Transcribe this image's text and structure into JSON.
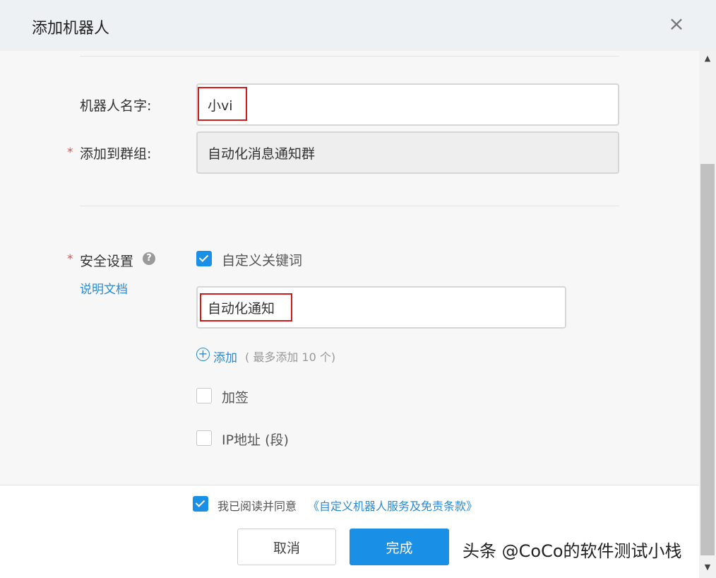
{
  "dialog": {
    "title": "添加机器人",
    "close_icon": "×"
  },
  "form": {
    "robot_name_label": "机器人名字:",
    "robot_name_value": "小vi",
    "group_label": "添加到群组:",
    "group_value": "自动化消息通知群",
    "required_mark": "*"
  },
  "security": {
    "label": "安全设置",
    "help_icon": "?",
    "doc_link": "说明文档",
    "keyword_option": {
      "label": "自定义关键词",
      "checked": true
    },
    "keyword_value": "自动化通知",
    "add_link": "添加",
    "add_hint": "( 最多添加 10 个)",
    "sign_option": {
      "label": "加签",
      "checked": false
    },
    "ip_option": {
      "label": "IP地址 (段)",
      "checked": false
    }
  },
  "footer": {
    "agree_checked": true,
    "agree_text": "我已阅读并同意",
    "agree_link": "《自定义机器人服务及免责条款》",
    "cancel_label": "取消",
    "done_label": "完成"
  },
  "watermark": "头条 @CoCo的软件测试小栈",
  "colors": {
    "accent": "#1a8fe6",
    "required": "#e05252",
    "highlight_box": "#d11b1b",
    "link": "#2a8ad6"
  }
}
